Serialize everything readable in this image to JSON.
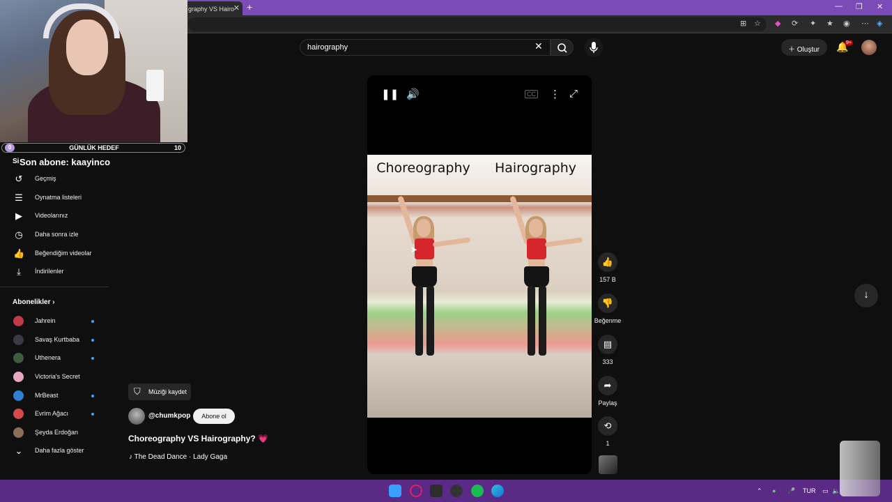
{
  "browser": {
    "tab_title": "graphy VS Hairo",
    "tab_close": "✕",
    "new_tab": "+",
    "window_controls": [
      "—",
      "❐",
      "✕"
    ]
  },
  "header": {
    "search_value": "hairography",
    "create_label": "Oluştur",
    "notification_badge": "9+"
  },
  "overlay": {
    "goal_start": "0",
    "goal_label": "GÜNLÜK HEDEF",
    "goal_end": "10",
    "last_sub": "Son abone: kaayinco",
    "side_header_partial": "Si"
  },
  "sidebar": {
    "items": [
      {
        "label": "Geçmiş",
        "icon": "history-icon",
        "glyph": "↺"
      },
      {
        "label": "Oynatma listeleri",
        "icon": "playlist-icon",
        "glyph": "☰"
      },
      {
        "label": "Videolarınız",
        "icon": "your-videos-icon",
        "glyph": "▶"
      },
      {
        "label": "Daha sonra izle",
        "icon": "watch-later-icon",
        "glyph": "◷"
      },
      {
        "label": "Beğendiğim videolar",
        "icon": "liked-icon",
        "glyph": "👍"
      },
      {
        "label": "İndirilenler",
        "icon": "download-icon",
        "glyph": "⤓"
      }
    ],
    "subscriptions_header": "Abonelikler",
    "subscriptions": [
      {
        "label": "Jahrein",
        "color": "#c0394a",
        "dot": true
      },
      {
        "label": "Savaş Kurtbaba",
        "color": "#3a3a44",
        "dot": true
      },
      {
        "label": "Uthenera",
        "color": "#3f5b3f",
        "dot": true
      },
      {
        "label": "Victoria's Secret",
        "color": "#e7a6c0",
        "dot": false
      },
      {
        "label": "MrBeast",
        "color": "#2f7fd6",
        "dot": true
      },
      {
        "label": "Evrim Ağacı",
        "color": "#d44a4a",
        "dot": true
      },
      {
        "label": "Şeyda Erdoğan",
        "color": "#8a6d5a",
        "dot": false
      }
    ],
    "show_more": "Daha fazla göster"
  },
  "short": {
    "save_music": "Müziği kaydet",
    "channel": "@chumkpop",
    "subscribe": "Abone ol",
    "title": "Choreography VS Hairography? 💗",
    "music": "♪ The Dead Dance · Lady Gaga",
    "caption_left": "Choreography",
    "caption_right": "Hairography"
  },
  "actions": {
    "likes": "157 B",
    "dislike_label": "Beğenme",
    "comments": "333",
    "share_label": "Paylaş",
    "remix": "1"
  },
  "taskbar": {
    "lang": "TUR"
  },
  "colors": {
    "tab_bar": "#7b4bb8",
    "taskbar": "#5b2a86",
    "background": "#0f0f0f"
  }
}
